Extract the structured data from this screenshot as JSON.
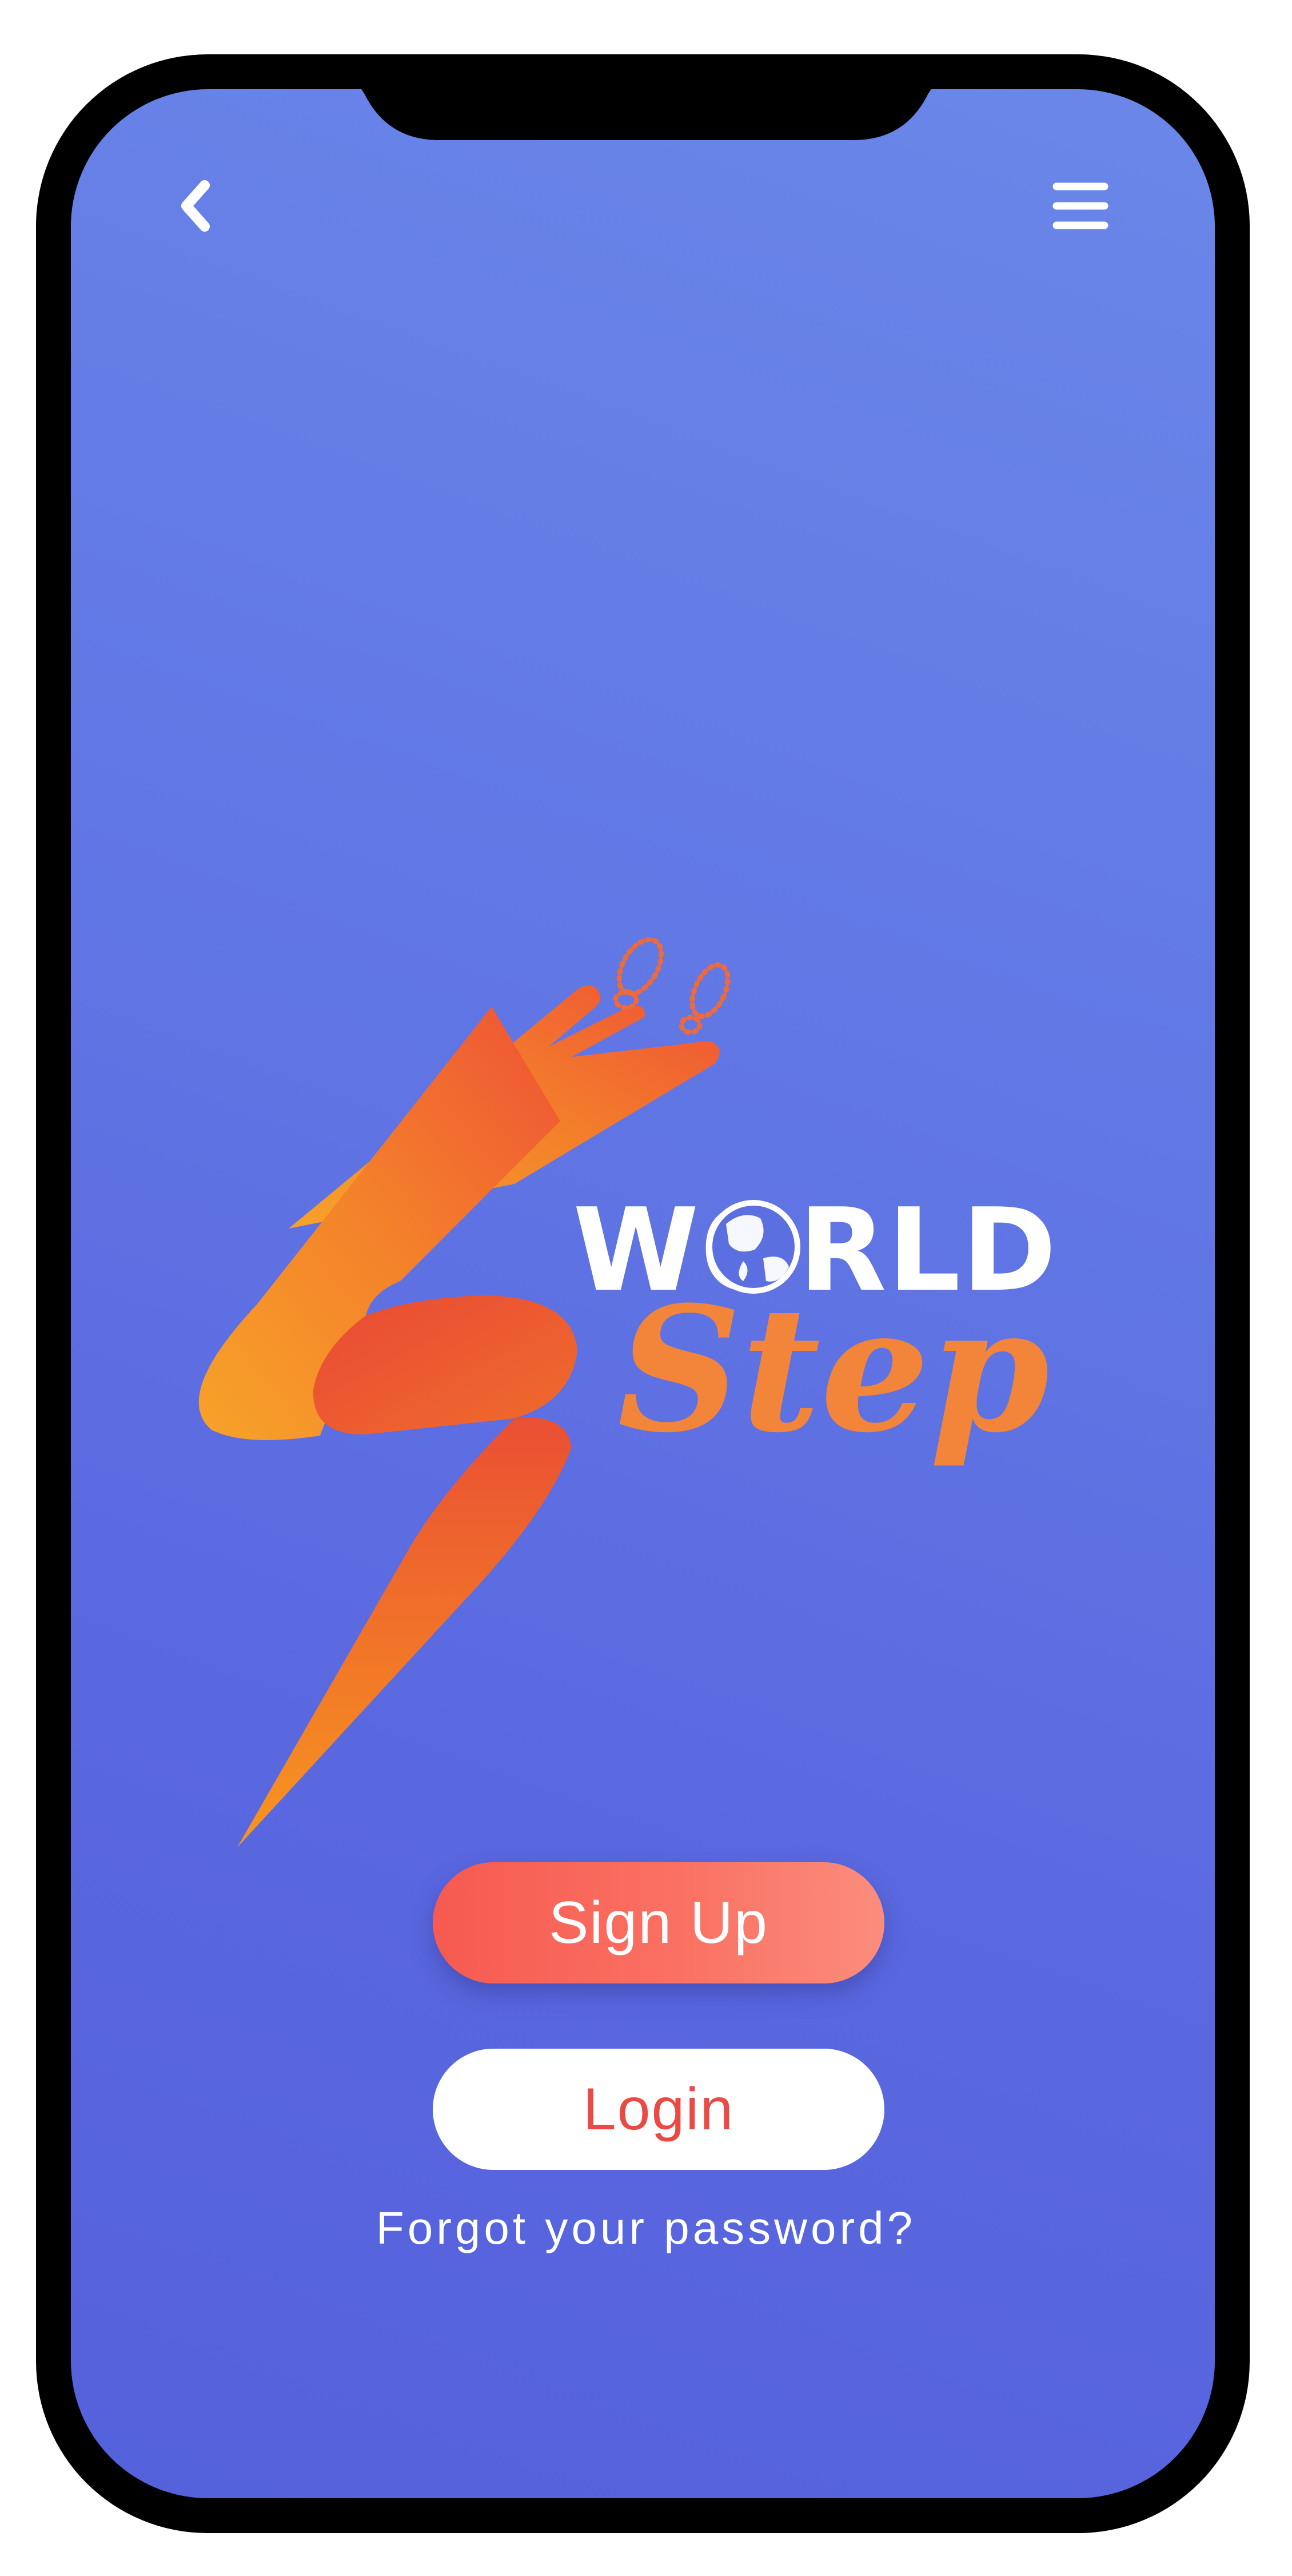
{
  "brand": {
    "line1": "WORLD",
    "line2": "Step"
  },
  "actions": {
    "signup_label": "Sign Up",
    "login_label": "Login",
    "forgot_label": "Forgot your password?"
  },
  "icons": {
    "back": "chevron-left-icon",
    "menu": "hamburger-menu-icon"
  },
  "colors": {
    "background_top": "#6a87e9",
    "background_bottom": "#5461db",
    "accent_orange": "#f48a26",
    "accent_red": "#ea4a45",
    "signup_gradient_start": "#f65a50",
    "signup_gradient_end": "#fb8d7c"
  }
}
